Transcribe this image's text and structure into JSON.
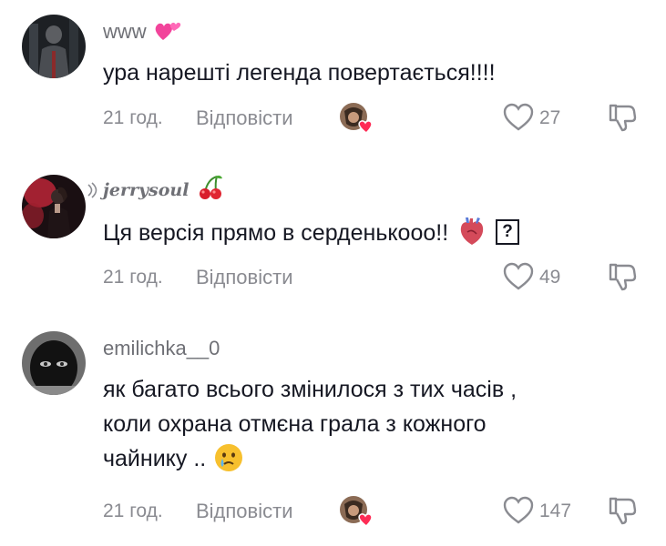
{
  "comments": [
    {
      "username": "www",
      "username_emoji": "heart-two-pink-icon",
      "text": "ура нарешті легенда повертається!!!!",
      "time": "21 год.",
      "reply_label": "Відповісти",
      "likes": "27"
    },
    {
      "username": "jerrysoul",
      "username_emoji": "cherries-icon",
      "text": "Ця версія прямо в серденькооо!!",
      "text_emoji": "anatomical-heart-icon",
      "unknown_glyph": "?",
      "time": "21 год.",
      "reply_label": "Відповісти",
      "likes": "49"
    },
    {
      "username": "emilichka__0",
      "text_lines": [
        "як багато всього змінилося з тих часів ,",
        "коли охрана отмєна грала з кожного",
        "чайнику .."
      ],
      "text_emoji": "crying-face-icon",
      "time": "21 год.",
      "reply_label": "Відповісти",
      "likes": "147"
    }
  ],
  "colors": {
    "text": "#161823",
    "muted": "#8a8b91",
    "heart_pink": "#fe2c55"
  }
}
